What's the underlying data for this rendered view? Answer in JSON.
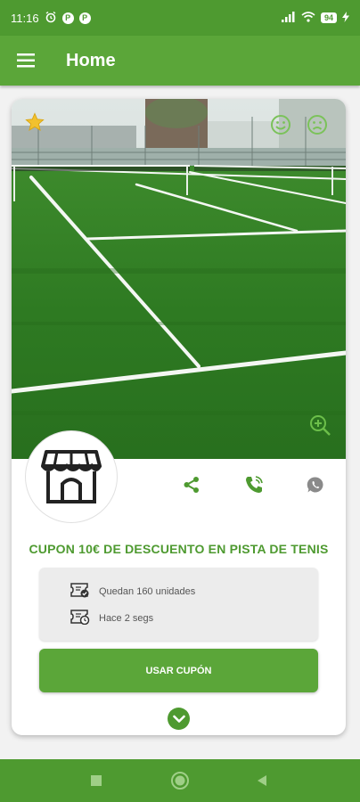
{
  "status": {
    "time": "11:16",
    "left_icons": [
      "alarm-icon",
      "p-badge-icon",
      "p-badge-icon"
    ],
    "right_icons": [
      "signal-icon",
      "wifi-icon",
      "battery-icon",
      "charging-icon"
    ],
    "battery": "94"
  },
  "appbar": {
    "title": "Home",
    "menu_icon": "menu-icon"
  },
  "card": {
    "hero_image": "tennis-court-photo",
    "favorite_icon": "star-icon",
    "like_icon": "smile-icon",
    "dislike_icon": "sad-icon",
    "zoom_icon": "zoom-in-icon",
    "store_icon": "store-icon",
    "actions": [
      "share-icon",
      "phone-icon",
      "whatsapp-icon"
    ],
    "coupon_title": "CUPON 10€  DE DESCUENTO EN PISTA DE TENIS",
    "info": {
      "units": "Quedan 160 unidades",
      "time_ago": "Hace 2 segs"
    },
    "use_button": "USAR CUPÓN",
    "expand_icon": "chevron-down-icon"
  },
  "colors": {
    "primary": "#5ba639",
    "primary_dark": "#4e9a30",
    "court": "#2f7d22"
  },
  "navbar": [
    "recents-square-icon",
    "home-circle-icon",
    "back-triangle-icon"
  ]
}
